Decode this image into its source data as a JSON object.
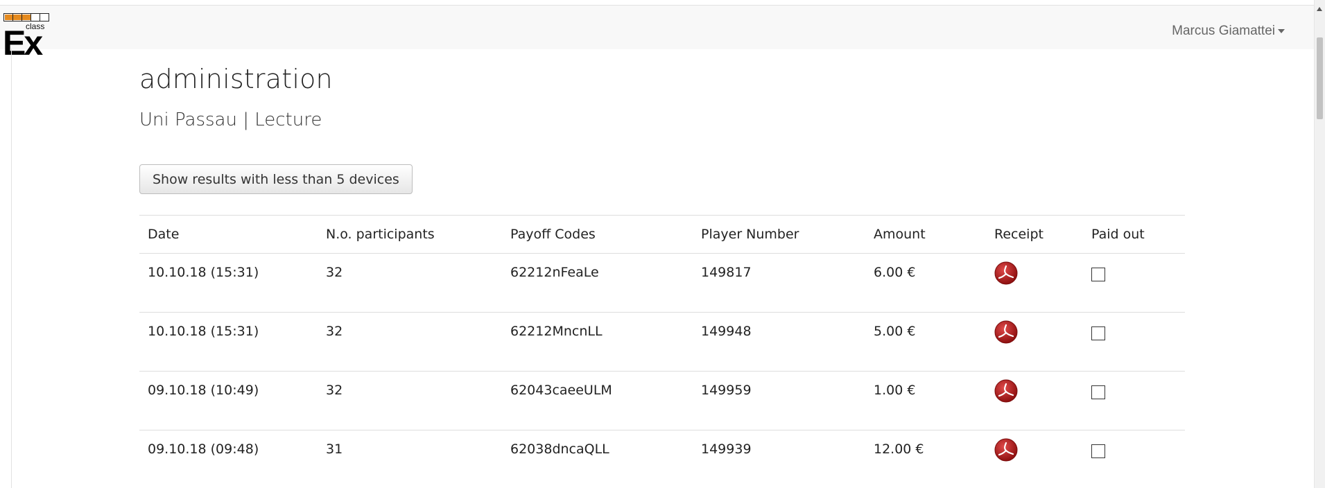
{
  "brand": {
    "logo_small": "class",
    "logo_big": "Ex",
    "accent_color": "#e58a1e"
  },
  "user_menu": {
    "name": "Marcus Giamattei",
    "icon": "caret-down-icon"
  },
  "page": {
    "title": "administration",
    "subtitle": "Uni Passau | Lecture"
  },
  "toggle_button": {
    "label": "Show results with less than 5 devices"
  },
  "table": {
    "headers": [
      "Date",
      "N.o. participants",
      "Payoff Codes",
      "Player Number",
      "Amount",
      "Receipt",
      "Paid out"
    ],
    "rows": [
      {
        "date": "10.10.18 (15:31)",
        "participants": "32",
        "payoff_code": "62212nFeaLe",
        "player_number": "149817",
        "amount": "6.00 €",
        "receipt_icon": "pdf-icon",
        "paid_out": false
      },
      {
        "date": "10.10.18 (15:31)",
        "participants": "32",
        "payoff_code": "62212MncnLL",
        "player_number": "149948",
        "amount": "5.00 €",
        "receipt_icon": "pdf-icon",
        "paid_out": false
      },
      {
        "date": "09.10.18 (10:49)",
        "participants": "32",
        "payoff_code": "62043caeeULM",
        "player_number": "149959",
        "amount": "1.00 €",
        "receipt_icon": "pdf-icon",
        "paid_out": false
      },
      {
        "date": "09.10.18 (09:48)",
        "participants": "31",
        "payoff_code": "62038dncaQLL",
        "player_number": "149939",
        "amount": "12.00 €",
        "receipt_icon": "pdf-icon",
        "paid_out": false
      }
    ]
  }
}
